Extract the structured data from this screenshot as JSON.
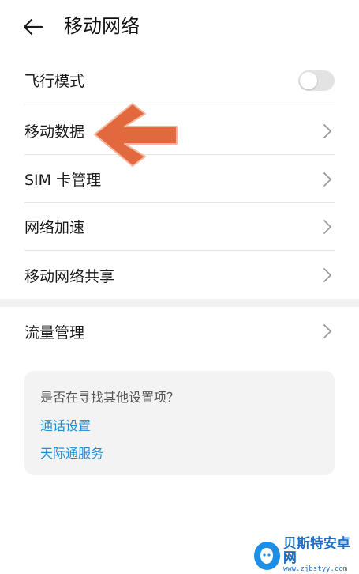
{
  "header": {
    "title": "移动网络"
  },
  "settings": {
    "airplane_mode": {
      "label": "飞行模式",
      "enabled": false
    },
    "mobile_data": {
      "label": "移动数据"
    },
    "sim_management": {
      "label": "SIM 卡管理"
    },
    "network_acceleration": {
      "label": "网络加速"
    },
    "hotspot": {
      "label": "移动网络共享"
    },
    "data_usage": {
      "label": "流量管理"
    }
  },
  "suggestions": {
    "question": "是否在寻找其他设置项？",
    "links": [
      "通话设置",
      "天际通服务"
    ]
  },
  "watermark": {
    "name": "贝斯特安卓网",
    "url": "www.zjbstyy.com"
  },
  "colors": {
    "link": "#1a8fd8",
    "arrow": "#e2683e",
    "toggle_off": "#e3e3e3"
  }
}
